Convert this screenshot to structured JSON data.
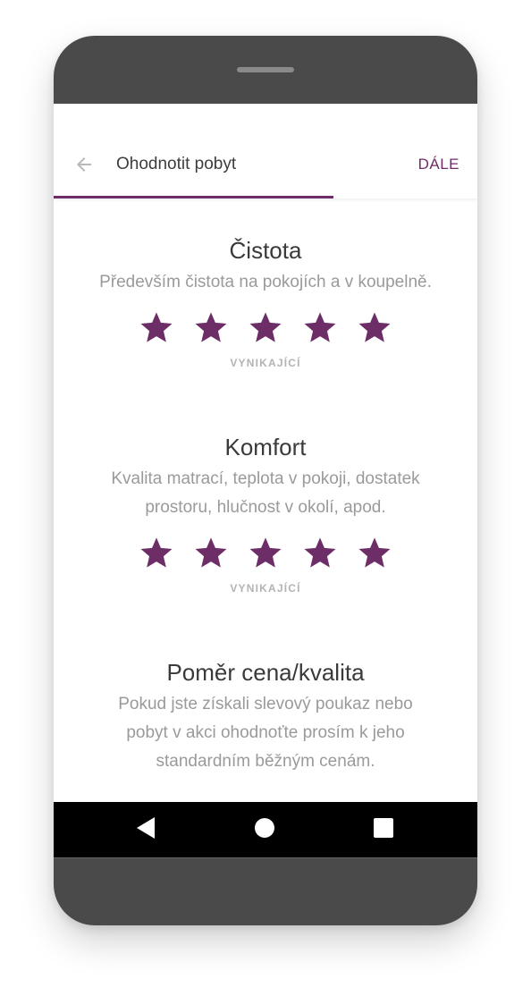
{
  "appbar": {
    "title": "Ohodnotit pobyt",
    "next_label": "DÁLE",
    "progress_fraction": 0.66
  },
  "sections": [
    {
      "title": "Čistota",
      "description": "Především čistota na pokojích a v koupelně.",
      "rating": 5,
      "max_rating": 5,
      "rating_label": "VYNIKAJÍCÍ"
    },
    {
      "title": "Komfort",
      "description": "Kvalita matrací, teplota v pokoji, dostatek prostoru, hlučnost v okolí, apod.",
      "rating": 5,
      "max_rating": 5,
      "rating_label": "VYNIKAJÍCÍ"
    },
    {
      "title": "Poměr cena/kvalita",
      "description": "Pokud jste získali slevový poukaz nebo pobyt v akci ohodnoťte prosím k jeho standardním běžným cenám."
    }
  ],
  "colors": {
    "accent": "#6d2e68",
    "phone_body": "#4a4a4a",
    "text_primary": "#3a3a3a",
    "text_secondary": "#9a9a9a"
  },
  "icons": {
    "back": "arrow-left-icon",
    "star": "star-icon",
    "nav_back": "triangle-back-icon",
    "nav_home": "circle-home-icon",
    "nav_recent": "square-recent-icon"
  }
}
